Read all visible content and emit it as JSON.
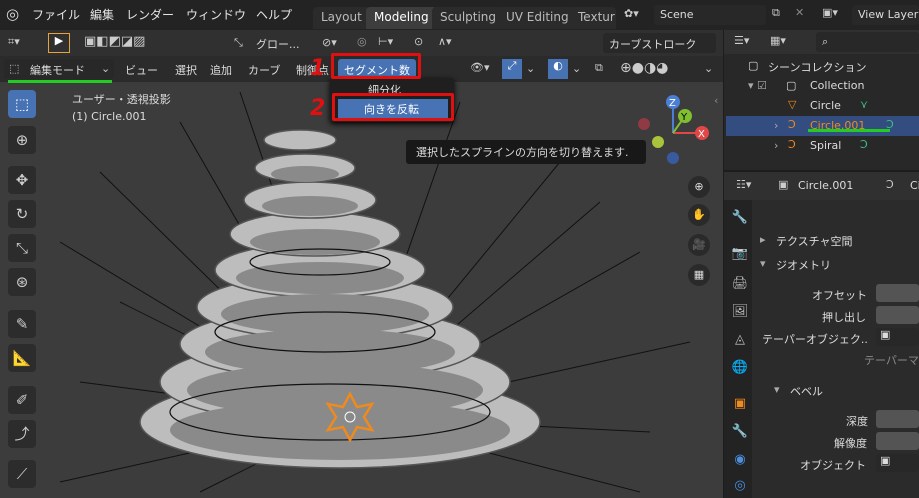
{
  "menu": {
    "file": "ファイル",
    "edit": "編集",
    "render": "レンダー",
    "window": "ウィンドウ",
    "help": "ヘルプ"
  },
  "workspaces": [
    "Layout",
    "Modeling",
    "Sculpting",
    "UV Editing",
    "Textur"
  ],
  "scene": {
    "name": "Scene",
    "view_layer": "View Layer"
  },
  "tool_header": {
    "orientation": "グロー...",
    "curve_stroke": "カーブストローク"
  },
  "editor_header": {
    "mode": "編集モード",
    "view": "ビュー",
    "select": "選択",
    "add": "追加",
    "curve": "カーブ",
    "control_points": "制御点",
    "segments": "セグメント数"
  },
  "dropdown": {
    "subdivide": "細分化",
    "switch_direction": "向きを反転"
  },
  "tooltip": "選択したスプラインの方向を切り替えます.",
  "viewport": {
    "view_name": "ユーザー・透視投影",
    "object_name": "(1) Circle.001"
  },
  "annotations": {
    "step1": "1",
    "step2": "2"
  },
  "gizmo": {
    "x": "X",
    "y": "Y",
    "z": "Z"
  },
  "outliner": {
    "scene_collection": "シーンコレクション",
    "collection": "Collection",
    "items": [
      "Circle",
      "Circle.001",
      "Spiral"
    ]
  },
  "properties": {
    "object": "Circle.001",
    "truncated": "Ci",
    "texture_space": "テクスチャ空間",
    "geometry": "ジオメトリ",
    "offset": "オフセット",
    "extrude": "押し出し",
    "taper_object": "テーパーオブジェク..",
    "taper_mode": "テーパーマ",
    "bevel": "ベベル",
    "depth": "深度",
    "resolution": "解像度",
    "object_label": "オブジェクト"
  },
  "colors": {
    "accent": "#4772b3",
    "highlight_red": "#e01010",
    "underline_green": "#22cc22",
    "selected_orange": "#f08a1c"
  }
}
